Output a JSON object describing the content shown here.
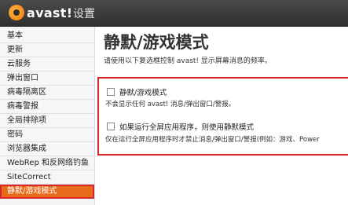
{
  "app": {
    "logo_text": "avast!",
    "window_title": "设置"
  },
  "sidebar": {
    "items": [
      {
        "label": "基本"
      },
      {
        "label": "更新"
      },
      {
        "label": "云服务"
      },
      {
        "label": "弹出窗口"
      },
      {
        "label": "病毒隔离区"
      },
      {
        "label": "病毒警报"
      },
      {
        "label": "全局排除项"
      },
      {
        "label": "密码"
      },
      {
        "label": "浏览器集成"
      },
      {
        "label": "WebRep 和反网络钓鱼"
      },
      {
        "label": "SiteCorrect"
      },
      {
        "label": "静默/游戏模式",
        "selected": true
      }
    ]
  },
  "main": {
    "title": "静默/游戏模式",
    "description": "请使用以下复选框控制 avast! 显示屏幕消息的频率。",
    "options": [
      {
        "label": "静默/游戏模式",
        "description": "不会显示任何 avast! 消息/弹出窗口/警报。",
        "checked": false
      },
      {
        "label": "如果运行全屏应用程序，则使用静默模式",
        "description": "仅在运行全屏应用程序时才禁止消息/弹出窗口/警报(例如：游戏、Power",
        "checked": false
      }
    ]
  },
  "colors": {
    "accent": "#e96a1a",
    "highlight": "#d8242b",
    "titlebar": "#3a3a3a"
  }
}
